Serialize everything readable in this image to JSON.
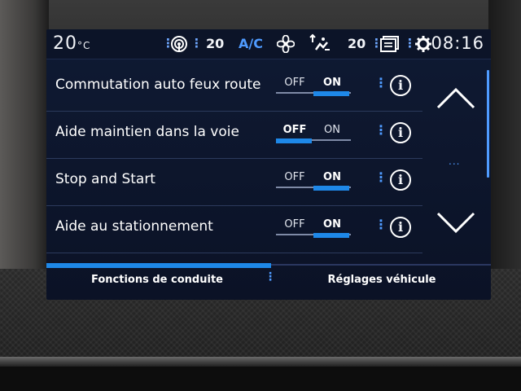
{
  "status_bar": {
    "temp_left": "20",
    "temp_unit": "°C",
    "fan_level_left": "20",
    "ac_label": "A/C",
    "temp_right": "20",
    "time": "08:16"
  },
  "settings": [
    {
      "label": "Commutation auto feux route",
      "off_label": "OFF",
      "on_label": "ON",
      "state": "ON"
    },
    {
      "label": "Aide maintien dans la voie",
      "off_label": "OFF",
      "on_label": "ON",
      "state": "OFF"
    },
    {
      "label": "Stop and Start",
      "off_label": "OFF",
      "on_label": "ON",
      "state": "ON"
    },
    {
      "label": "Aide au stationnement",
      "off_label": "OFF",
      "on_label": "ON",
      "state": "ON"
    }
  ],
  "tabs": [
    {
      "label": "Fonctions de conduite",
      "active": true
    },
    {
      "label": "Réglages véhicule",
      "active": false
    }
  ],
  "scroll_indicator": "...",
  "icons": {
    "status": [
      "signal-icon",
      "fan-icon",
      "air-distribution-icon",
      "screen-icon",
      "gear-icon"
    ],
    "row": [
      "more-vert-icon",
      "info-icon"
    ],
    "nav": [
      "chevron-up-icon",
      "chevron-down-icon"
    ]
  },
  "colors": {
    "accent": "#1e88e8",
    "background": "#0b1226",
    "text": "#ffffff"
  }
}
